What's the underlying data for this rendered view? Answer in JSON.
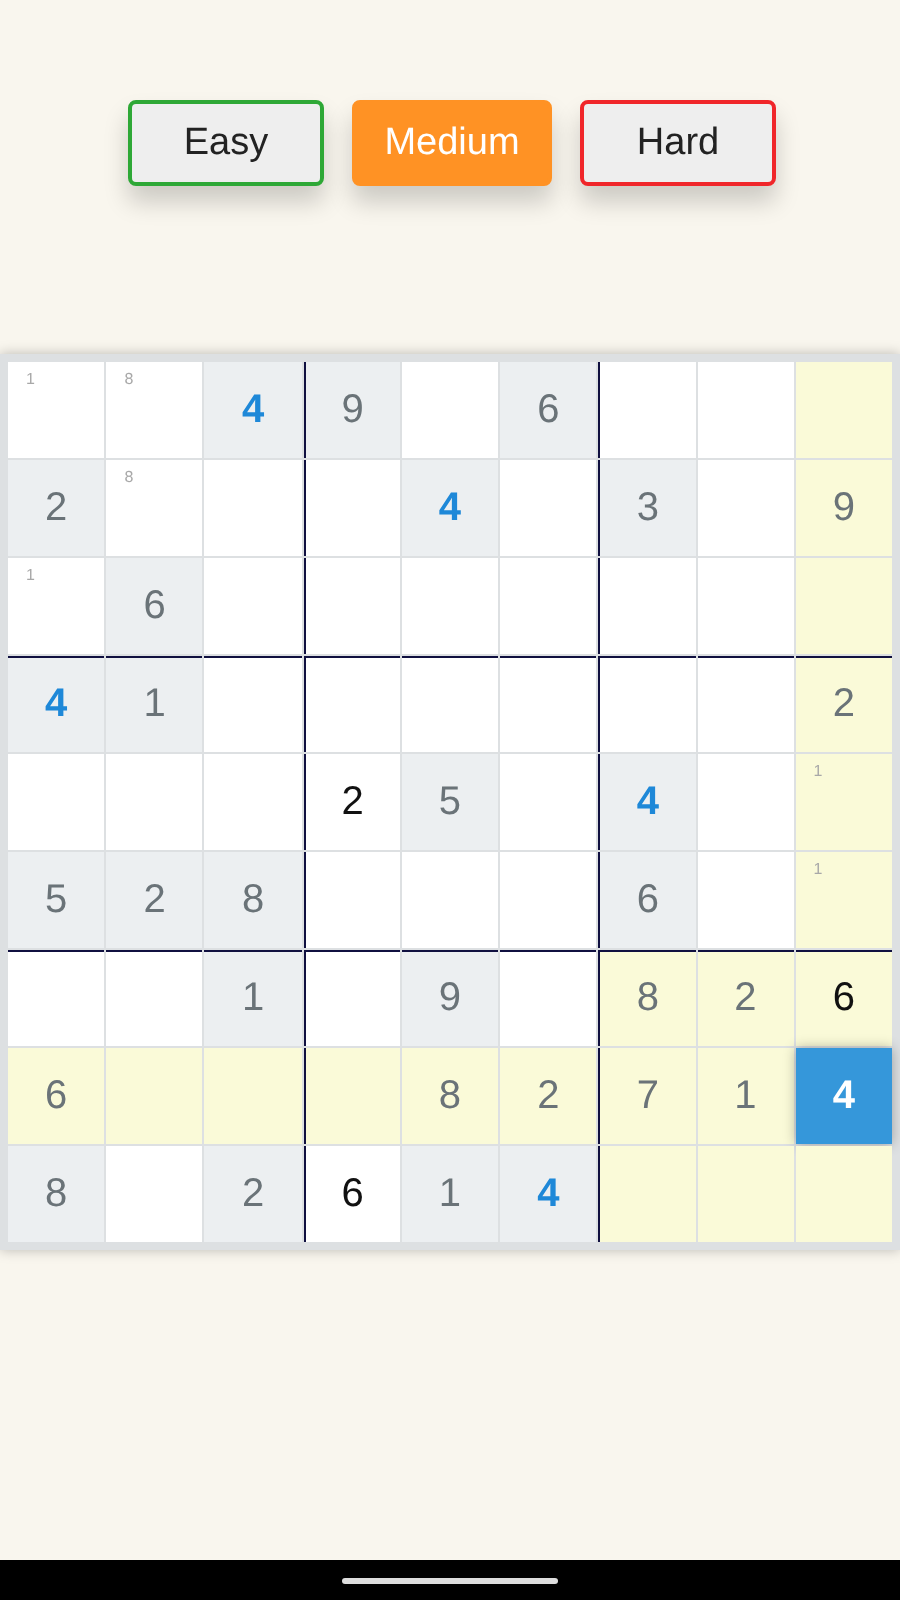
{
  "difficulty_buttons": [
    {
      "label": "Easy",
      "kind": "easy",
      "selected": false
    },
    {
      "label": "Medium",
      "kind": "medium",
      "selected": true
    },
    {
      "label": "Hard",
      "kind": "hard",
      "selected": false
    }
  ],
  "board": {
    "rows": [
      [
        {
          "value": "1",
          "kind": "note",
          "highlighted": false,
          "selected": false
        },
        {
          "value": "8",
          "kind": "note",
          "highlighted": false,
          "selected": false
        },
        {
          "value": "4",
          "kind": "given",
          "highlighted": false,
          "same_digit": true,
          "selected": false
        },
        {
          "value": "9",
          "kind": "given",
          "highlighted": false,
          "same_digit": false,
          "selected": false
        },
        {
          "kind": "empty",
          "highlighted": false,
          "selected": false
        },
        {
          "value": "6",
          "kind": "given",
          "highlighted": false,
          "same_digit": false,
          "selected": false
        },
        {
          "kind": "empty",
          "highlighted": false,
          "selected": false
        },
        {
          "kind": "empty",
          "highlighted": false,
          "selected": false
        },
        {
          "kind": "empty",
          "highlighted": true,
          "selected": false
        }
      ],
      [
        {
          "value": "2",
          "kind": "given",
          "highlighted": false,
          "same_digit": false,
          "selected": false
        },
        {
          "value": "8",
          "kind": "note",
          "highlighted": false,
          "selected": false
        },
        {
          "kind": "empty",
          "highlighted": false,
          "selected": false
        },
        {
          "kind": "empty",
          "highlighted": false,
          "selected": false
        },
        {
          "value": "4",
          "kind": "given",
          "highlighted": false,
          "same_digit": true,
          "selected": false
        },
        {
          "kind": "empty",
          "highlighted": false,
          "selected": false
        },
        {
          "value": "3",
          "kind": "given",
          "highlighted": false,
          "same_digit": false,
          "selected": false
        },
        {
          "kind": "empty",
          "highlighted": false,
          "selected": false
        },
        {
          "value": "9",
          "kind": "given",
          "highlighted": true,
          "same_digit": false,
          "selected": false
        }
      ],
      [
        {
          "value": "1",
          "kind": "note",
          "highlighted": false,
          "selected": false
        },
        {
          "value": "6",
          "kind": "given",
          "highlighted": false,
          "same_digit": false,
          "selected": false
        },
        {
          "kind": "empty",
          "highlighted": false,
          "selected": false
        },
        {
          "kind": "empty",
          "highlighted": false,
          "selected": false
        },
        {
          "kind": "empty",
          "highlighted": false,
          "selected": false
        },
        {
          "kind": "empty",
          "highlighted": false,
          "selected": false
        },
        {
          "kind": "empty",
          "highlighted": false,
          "selected": false
        },
        {
          "kind": "empty",
          "highlighted": false,
          "selected": false
        },
        {
          "kind": "empty",
          "highlighted": true,
          "selected": false
        }
      ],
      [
        {
          "value": "4",
          "kind": "given",
          "highlighted": false,
          "same_digit": true,
          "selected": false
        },
        {
          "value": "1",
          "kind": "given",
          "highlighted": false,
          "same_digit": false,
          "selected": false
        },
        {
          "kind": "empty",
          "highlighted": false,
          "selected": false
        },
        {
          "kind": "empty",
          "highlighted": false,
          "selected": false
        },
        {
          "kind": "empty",
          "highlighted": false,
          "selected": false
        },
        {
          "kind": "empty",
          "highlighted": false,
          "selected": false
        },
        {
          "kind": "empty",
          "highlighted": false,
          "selected": false
        },
        {
          "kind": "empty",
          "highlighted": false,
          "selected": false
        },
        {
          "value": "2",
          "kind": "given",
          "highlighted": true,
          "same_digit": false,
          "selected": false
        }
      ],
      [
        {
          "kind": "empty",
          "highlighted": false,
          "selected": false
        },
        {
          "kind": "empty",
          "highlighted": false,
          "selected": false
        },
        {
          "kind": "empty",
          "highlighted": false,
          "selected": false
        },
        {
          "value": "2",
          "kind": "entered",
          "highlighted": false,
          "same_digit": false,
          "selected": false
        },
        {
          "value": "5",
          "kind": "given",
          "highlighted": false,
          "same_digit": false,
          "selected": false
        },
        {
          "kind": "empty",
          "highlighted": false,
          "selected": false
        },
        {
          "value": "4",
          "kind": "given",
          "highlighted": false,
          "same_digit": true,
          "selected": false
        },
        {
          "kind": "empty",
          "highlighted": false,
          "selected": false
        },
        {
          "value": "1",
          "kind": "note",
          "highlighted": true,
          "selected": false
        }
      ],
      [
        {
          "value": "5",
          "kind": "given",
          "highlighted": false,
          "same_digit": false,
          "selected": false
        },
        {
          "value": "2",
          "kind": "given",
          "highlighted": false,
          "same_digit": false,
          "selected": false
        },
        {
          "value": "8",
          "kind": "given",
          "highlighted": false,
          "same_digit": false,
          "selected": false
        },
        {
          "kind": "empty",
          "highlighted": false,
          "selected": false
        },
        {
          "kind": "empty",
          "highlighted": false,
          "selected": false
        },
        {
          "kind": "empty",
          "highlighted": false,
          "selected": false
        },
        {
          "value": "6",
          "kind": "given",
          "highlighted": false,
          "same_digit": false,
          "selected": false
        },
        {
          "kind": "empty",
          "highlighted": false,
          "selected": false
        },
        {
          "value": "1",
          "kind": "note",
          "highlighted": true,
          "selected": false
        }
      ],
      [
        {
          "kind": "empty",
          "highlighted": false,
          "selected": false
        },
        {
          "kind": "empty",
          "highlighted": false,
          "selected": false
        },
        {
          "value": "1",
          "kind": "given",
          "highlighted": false,
          "same_digit": false,
          "selected": false
        },
        {
          "kind": "empty",
          "highlighted": false,
          "selected": false
        },
        {
          "value": "9",
          "kind": "given",
          "highlighted": false,
          "same_digit": false,
          "selected": false
        },
        {
          "kind": "empty",
          "highlighted": false,
          "selected": false
        },
        {
          "value": "8",
          "kind": "given",
          "highlighted": true,
          "same_digit": false,
          "selected": false
        },
        {
          "value": "2",
          "kind": "given",
          "highlighted": true,
          "same_digit": false,
          "selected": false
        },
        {
          "value": "6",
          "kind": "entered",
          "highlighted": true,
          "same_digit": false,
          "selected": false
        }
      ],
      [
        {
          "value": "6",
          "kind": "given",
          "highlighted": true,
          "same_digit": false,
          "selected": false
        },
        {
          "kind": "empty",
          "highlighted": true,
          "selected": false
        },
        {
          "kind": "empty",
          "highlighted": true,
          "selected": false
        },
        {
          "kind": "empty",
          "highlighted": true,
          "selected": false
        },
        {
          "value": "8",
          "kind": "given",
          "highlighted": true,
          "same_digit": false,
          "selected": false
        },
        {
          "value": "2",
          "kind": "given",
          "highlighted": true,
          "same_digit": false,
          "selected": false
        },
        {
          "value": "7",
          "kind": "given",
          "highlighted": true,
          "same_digit": false,
          "selected": false
        },
        {
          "value": "1",
          "kind": "given",
          "highlighted": true,
          "same_digit": false,
          "selected": false
        },
        {
          "value": "4",
          "kind": "entered",
          "highlighted": false,
          "same_digit": true,
          "selected": true
        }
      ],
      [
        {
          "value": "8",
          "kind": "given",
          "highlighted": false,
          "same_digit": false,
          "selected": false
        },
        {
          "kind": "empty",
          "highlighted": false,
          "selected": false
        },
        {
          "value": "2",
          "kind": "given",
          "highlighted": false,
          "same_digit": false,
          "selected": false
        },
        {
          "value": "6",
          "kind": "entered",
          "highlighted": false,
          "same_digit": false,
          "selected": false
        },
        {
          "value": "1",
          "kind": "given",
          "highlighted": false,
          "same_digit": false,
          "selected": false
        },
        {
          "value": "4",
          "kind": "given",
          "highlighted": false,
          "same_digit": true,
          "selected": false
        },
        {
          "kind": "empty",
          "highlighted": true,
          "selected": false
        },
        {
          "kind": "empty",
          "highlighted": true,
          "selected": false
        },
        {
          "kind": "empty",
          "highlighted": true,
          "selected": false
        }
      ]
    ]
  }
}
